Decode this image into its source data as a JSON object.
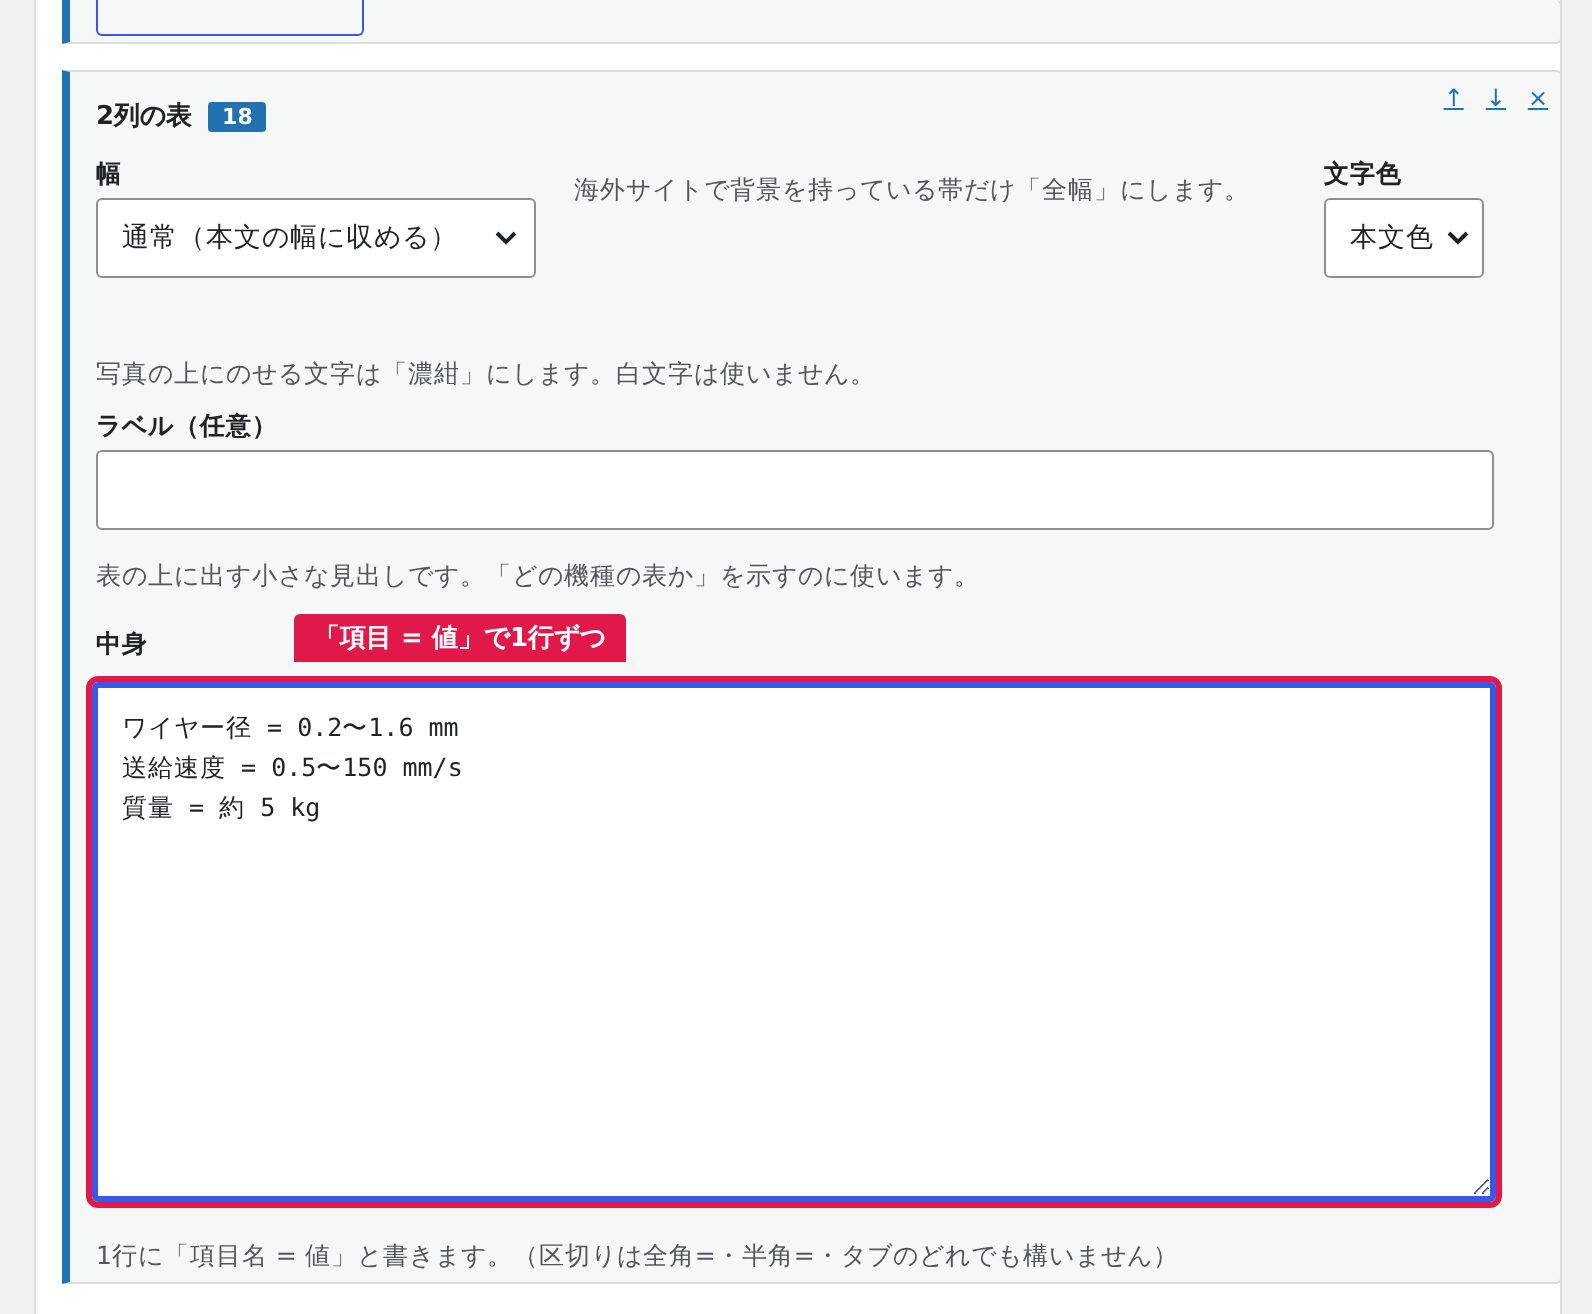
{
  "block": {
    "title": "2列の表",
    "badge": "18",
    "actions": [
      "↑",
      "↓",
      "×"
    ],
    "width_field": {
      "label": "幅",
      "value": "通常（本文の幅に収める）"
    },
    "width_help": "海外サイトで背景を持っている帯だけ「全幅」にします。",
    "color_field": {
      "label": "文字色",
      "value": "本文色"
    },
    "color_help": "写真の上にのせる文字は「濃紺」にします。白文字は使いません。",
    "label_field": {
      "label": "ラベル（任意）"
    },
    "label_help": "表の上に出す小さな見出しです。「どの機種の表か」を示すのに使います。",
    "content_field": {
      "label": "中身",
      "tooltip": "「項目 = 値」で1行ずつ",
      "value": "ワイヤー径 = 0.2〜1.6 mm\n送給速度 = 0.5〜150 mm/s\n質量 = 約 5 kg",
      "focused": true
    },
    "content_help": "1行に「項目名 = 値」と書きます。（区切りは全角=・半角=・タブのどれでも構いません）"
  }
}
